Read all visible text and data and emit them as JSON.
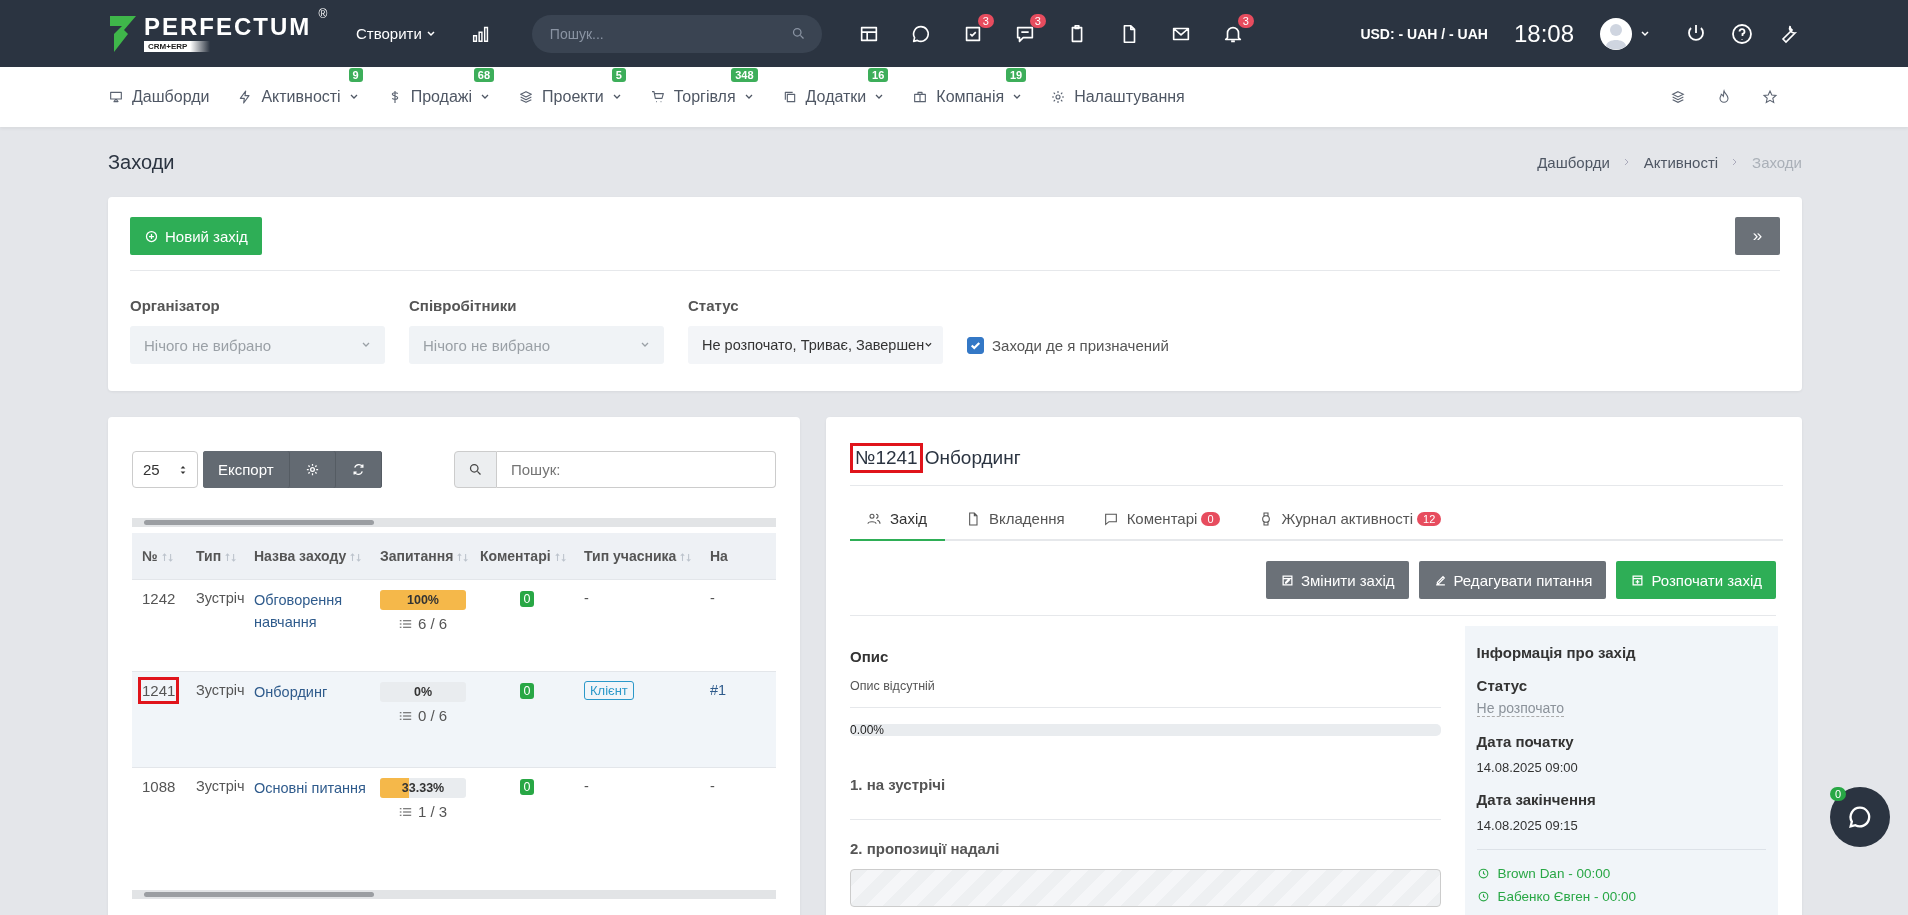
{
  "header": {
    "logo": {
      "name": "PERFECTUM",
      "mark": "®",
      "sub": "CRM+ERP"
    },
    "create_menu": "Створити",
    "search": {
      "placeholder": "Пошук..."
    },
    "icons": [
      {
        "kind": "calendar"
      },
      {
        "kind": "chat"
      },
      {
        "kind": "tasks",
        "badge": "3"
      },
      {
        "kind": "messages",
        "badge": "3"
      },
      {
        "kind": "clipboard"
      },
      {
        "kind": "file"
      },
      {
        "kind": "mail"
      },
      {
        "kind": "bell",
        "badge": "3"
      }
    ],
    "currency": "USD: - UAH / - UAH",
    "time": "18:08"
  },
  "nav": {
    "items": [
      {
        "kind": "monitor",
        "label": "Дашборди",
        "dropdown": false
      },
      {
        "kind": "bolt",
        "label": "Активності",
        "badge": "9",
        "dropdown": true
      },
      {
        "kind": "dollar",
        "label": "Продажі",
        "badge": "68",
        "dropdown": true
      },
      {
        "kind": "layers",
        "label": "Проекти",
        "badge": "5",
        "dropdown": true
      },
      {
        "kind": "cart",
        "label": "Торгівля",
        "badge": "348",
        "dropdown": true
      },
      {
        "kind": "copy",
        "label": "Додатки",
        "badge": "16",
        "dropdown": true
      },
      {
        "kind": "briefcase",
        "label": "Компанія",
        "badge": "19",
        "dropdown": true
      },
      {
        "kind": "gear",
        "label": "Налаштування",
        "dropdown": false
      }
    ]
  },
  "page_title": "Заходи",
  "breadcrumbs": [
    {
      "label": "Дашборди",
      "current": false
    },
    {
      "label": "Активності",
      "current": false
    },
    {
      "label": "Заходи",
      "current": true
    }
  ],
  "filters": {
    "new_button": "Новий захід",
    "expand_button": "»",
    "fields": [
      {
        "label": "Організатор",
        "placeholder": "Нічого не вибрано"
      },
      {
        "label": "Співробітники",
        "placeholder": "Нічого не вибрано"
      },
      {
        "label": "Статус",
        "value": "Не розпочато, Триває, Завершен"
      }
    ],
    "checkbox": {
      "label": "Заходи де я призначений",
      "checked": true
    }
  },
  "table": {
    "page_size": "25",
    "export_button": "Експорт",
    "search": {
      "placeholder": "Пошук:"
    },
    "columns": [
      "№",
      "Тип",
      "Назва заходу",
      "Запитання",
      "Коментарі",
      "Тип учасника",
      "На"
    ],
    "rows": [
      {
        "number": "1242",
        "type": "Зустріч",
        "name": "Обговорення навчання",
        "percent": "100%",
        "level": 1,
        "answered": "6 / 6",
        "comments": "0",
        "participant_type": "-",
        "column_7": "-",
        "selected": false,
        "highlighted": false
      },
      {
        "number": "1241",
        "type": "Зустріч",
        "name": "Онбординг",
        "percent": "0%",
        "level": 0,
        "answered": "0 / 6",
        "comments": "0",
        "participant_type": "Клієнт",
        "column_7": "#1",
        "selected": true,
        "highlighted": true
      },
      {
        "number": "1088",
        "type": "Зустріч",
        "name": "Основні питання",
        "percent": "33.33%",
        "level": 0.3333,
        "answered": "1 / 3",
        "comments": "0",
        "participant_type": "-",
        "column_7": "-",
        "selected": false,
        "highlighted": false
      }
    ]
  },
  "detail": {
    "number": "№1241",
    "number_highlighted": true,
    "title": "Онбординг",
    "tabs": [
      {
        "kind": "users",
        "label": "Захід",
        "selected": true
      },
      {
        "kind": "file",
        "label": "Вкладення",
        "selected": false
      },
      {
        "kind": "comment",
        "label": "Коментарі",
        "badge": "0",
        "selected": false
      },
      {
        "kind": "watch",
        "label": "Журнал активності",
        "badge": "12",
        "selected": false
      }
    ],
    "buttons": [
      {
        "kind": "edit-event",
        "label": "Змінити захід"
      },
      {
        "kind": "edit-questions",
        "label": "Редагувати питання"
      },
      {
        "kind": "start",
        "label": "Розпочати захід"
      }
    ],
    "description": {
      "heading": "Опис",
      "text": "Опис відсутній"
    },
    "progress": {
      "label": "0.00%",
      "level": 0
    },
    "questions": [
      {
        "kind": "plain",
        "label": "1. на зустрічі"
      },
      {
        "kind": "field",
        "label": "2. пропозиції надалі"
      }
    ],
    "info": {
      "heading": "Інформація про захід",
      "status_label": "Статус",
      "status": "Не розпочато",
      "start_label": "Дата початку",
      "start": "14.08.2025 09:00",
      "end_label": "Дата закінчення",
      "end": "14.08.2025 09:15",
      "schedule": [
        "Brown Dan - 00:00",
        "Бабенко Євген - 00:00"
      ]
    }
  },
  "chat": {
    "badge": "0"
  }
}
